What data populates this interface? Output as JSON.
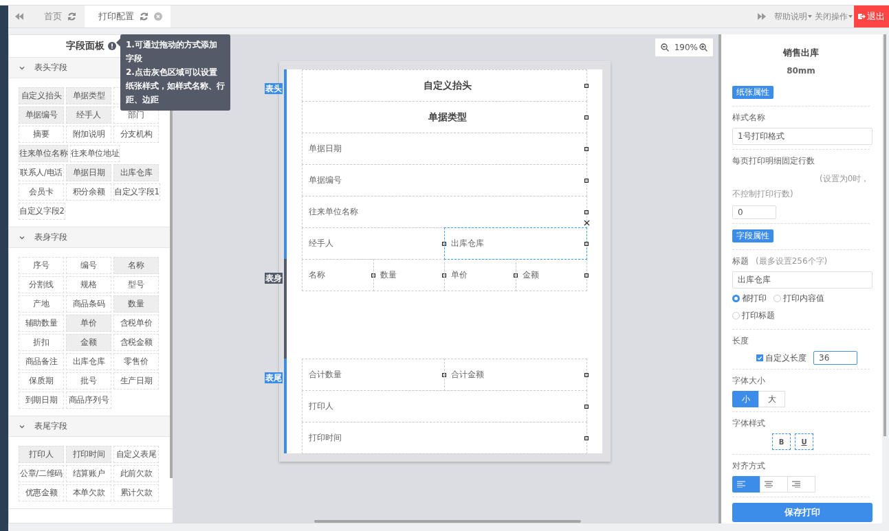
{
  "tabs_bar": {
    "tabs": [
      {
        "label": "首页",
        "selected": false,
        "closable": false
      },
      {
        "label": "打印配置",
        "selected": true,
        "closable": true
      }
    ],
    "menus": [
      {
        "label": "帮助说明"
      },
      {
        "label": "关闭操作"
      }
    ],
    "logout": "退出"
  },
  "field_panel": {
    "title": "字段面板",
    "tooltip": [
      "1.可通过拖动的方式添加字段",
      "2.点击灰色区域可以设置纸张样式，如样式名称、行距、边距"
    ],
    "groups": [
      {
        "title": "表头字段",
        "expanded": true,
        "chips": [
          {
            "label": "自定义抬头",
            "used": true
          },
          {
            "label": "单据类型",
            "used": true
          },
          {
            "covered": true
          },
          {
            "label": "单据编号",
            "used": true
          },
          {
            "label": "经手人",
            "used": true
          },
          {
            "label": "部门",
            "used": false
          },
          {
            "label": "摘要",
            "used": false
          },
          {
            "label": "附加说明",
            "used": false
          },
          {
            "label": "分支机构",
            "used": false
          },
          {
            "label": "往来单位名称",
            "used": true
          },
          {
            "label": "往来单位地址",
            "used": false
          },
          {
            "label": "联系人/电话",
            "used": false
          },
          {
            "label": "单据日期",
            "used": true
          },
          {
            "label": "出库仓库",
            "used": true
          },
          {
            "label": "会员卡",
            "used": false
          },
          {
            "label": "积分余额",
            "used": false
          },
          {
            "label": "自定义字段1",
            "used": false
          },
          {
            "label": "自定义字段2",
            "used": false
          }
        ]
      },
      {
        "title": "表身字段",
        "expanded": true,
        "chips": [
          {
            "label": "序号",
            "used": false
          },
          {
            "label": "编号",
            "used": false
          },
          {
            "label": "名称",
            "used": true
          },
          {
            "label": "分割线",
            "used": false
          },
          {
            "label": "规格",
            "used": false
          },
          {
            "label": "型号",
            "used": false
          },
          {
            "label": "产地",
            "used": false
          },
          {
            "label": "商品条码",
            "used": false
          },
          {
            "label": "数量",
            "used": true
          },
          {
            "label": "辅助数量",
            "used": false
          },
          {
            "label": "单价",
            "used": true
          },
          {
            "label": "含税单价",
            "used": false
          },
          {
            "label": "折扣",
            "used": false
          },
          {
            "label": "金额",
            "used": true
          },
          {
            "label": "含税金额",
            "used": false
          },
          {
            "label": "商品备注",
            "used": false
          },
          {
            "label": "出库仓库",
            "used": false
          },
          {
            "label": "零售价",
            "used": false
          },
          {
            "label": "保质期",
            "used": false
          },
          {
            "label": "批号",
            "used": false
          },
          {
            "label": "生产日期",
            "used": false
          },
          {
            "label": "到期日期",
            "used": false
          },
          {
            "label": "商品序列号",
            "used": false
          }
        ]
      },
      {
        "title": "表尾字段",
        "expanded": true,
        "chips": [
          {
            "label": "打印人",
            "used": true
          },
          {
            "label": "打印时间",
            "used": true
          },
          {
            "label": "自定义表尾",
            "used": false
          },
          {
            "label": "公章/二维码",
            "used": false
          },
          {
            "label": "结算账户",
            "used": false
          },
          {
            "label": "此前欠款",
            "used": false
          },
          {
            "label": "优惠金额",
            "used": false
          },
          {
            "label": "本单欠款",
            "used": false
          },
          {
            "label": "累计欠款",
            "used": false
          }
        ]
      }
    ]
  },
  "canvas": {
    "zoom": "190%",
    "sections": [
      {
        "label": "表头",
        "kind": "head",
        "color": "#3c8dea",
        "rows": [
          {
            "cells": [
              {
                "text": "自定义抬头",
                "kind": "title",
                "selected": false
              }
            ]
          },
          {
            "cells": [
              {
                "text": "单据类型",
                "kind": "title",
                "selected": false
              }
            ]
          },
          {
            "cells": [
              {
                "text": "单据日期",
                "kind": "label",
                "selected": false
              }
            ]
          },
          {
            "cells": [
              {
                "text": "单据编号",
                "kind": "label",
                "selected": false
              }
            ]
          },
          {
            "cells": [
              {
                "text": "往来单位名称",
                "kind": "label",
                "selected": false
              }
            ]
          },
          {
            "cells": [
              {
                "text": "经手人",
                "kind": "label",
                "selected": false
              },
              {
                "text": "出库仓库",
                "kind": "label",
                "selected": true
              }
            ]
          }
        ]
      },
      {
        "label": "表身",
        "kind": "body",
        "color": "#555a68",
        "rows": [
          {
            "cells": [
              {
                "text": "名称",
                "kind": "label",
                "selected": false
              },
              {
                "text": "数量",
                "kind": "label",
                "selected": false
              },
              {
                "text": "单价",
                "kind": "label",
                "selected": false
              },
              {
                "text": "金额",
                "kind": "label",
                "selected": false
              }
            ]
          }
        ]
      },
      {
        "label": "表尾",
        "kind": "foot",
        "color": "#3c8dea",
        "rows": [
          {
            "cells": [
              {
                "text": "合计数量",
                "kind": "label",
                "selected": false
              },
              {
                "text": "合计金额",
                "kind": "label",
                "selected": false
              }
            ]
          },
          {
            "cells": [
              {
                "text": "打印人",
                "kind": "label",
                "selected": false
              }
            ]
          },
          {
            "cells": [
              {
                "text": "打印时间",
                "kind": "label",
                "selected": false
              }
            ]
          }
        ]
      }
    ]
  },
  "properties": {
    "title": "销售出库",
    "subtitle": "80mm",
    "paper": {
      "badge": "纸张属性",
      "style_name_label": "样式名称",
      "style_name": "1号打印格式",
      "rows_label": "每页打印明细固定行数",
      "rows_hint": "(设置为0时，不控制打印行数)",
      "rows_value": "0"
    },
    "field": {
      "badge": "字段属性",
      "title_label": "标题",
      "title_hint": "(最多设置256个字)",
      "title_value": "出库仓库",
      "print_options": [
        {
          "label": "都打印",
          "selected": true
        },
        {
          "label": "打印内容值",
          "selected": false
        },
        {
          "label": "打印标题",
          "selected": false
        }
      ],
      "length_label": "长度",
      "custom_length": {
        "label": "自定义长度",
        "checked": true,
        "value": "36"
      },
      "font_size_label": "字体大小",
      "font_sizes": [
        {
          "label": "小",
          "selected": true
        },
        {
          "label": "大",
          "selected": false
        }
      ],
      "font_style_label": "字体样式",
      "font_styles": [
        {
          "label": "B",
          "selected": false
        },
        {
          "label": "U",
          "selected": false
        }
      ],
      "align_label": "对齐方式",
      "aligns": [
        {
          "kind": "left",
          "selected": true
        },
        {
          "kind": "center",
          "selected": false
        },
        {
          "kind": "right",
          "selected": false
        }
      ]
    },
    "save": "保存打印"
  }
}
